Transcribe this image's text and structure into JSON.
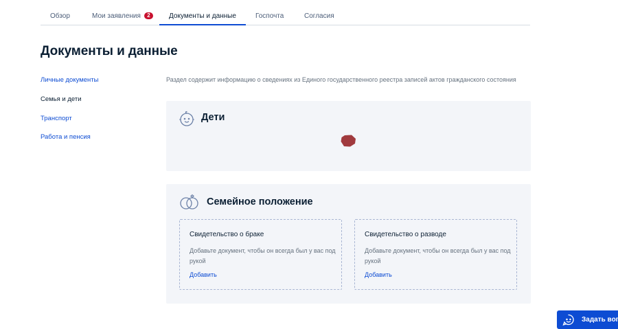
{
  "tabs": {
    "overview": "Обзор",
    "applications": "Мои заявления",
    "applications_badge": "2",
    "documents": "Документы и данные",
    "gospochta": "Госпочта",
    "consents": "Согласия"
  },
  "page": {
    "title": "Документы и данные",
    "description": "Раздел содержит информацию о сведениях из Единого государственного реестра записей актов гражданского состояния"
  },
  "sidebar": {
    "items": [
      {
        "label": "Личные документы"
      },
      {
        "label": "Семья и дети"
      },
      {
        "label": "Транспорт"
      },
      {
        "label": "Работа и пенсия"
      }
    ]
  },
  "children_card": {
    "title": "Дети"
  },
  "family_card": {
    "title": "Семейное положение",
    "marriage": {
      "title": "Свидетельство о браке",
      "text": "Добавьте документ, чтобы он всегда был у вас под рукой",
      "link": "Добавить"
    },
    "divorce": {
      "title": "Свидетельство о разводе",
      "text": "Добавьте документ, чтобы он всегда был у вас под рукой",
      "link": "Добавить"
    }
  },
  "help": {
    "label": "Задать вопрос"
  },
  "colors": {
    "accent": "#0d4cd3",
    "badge": "#c8102e",
    "spinner": "#a03a3e"
  },
  "icons": {
    "children": "baby-face-icon",
    "family": "wedding-rings-icon",
    "help": "chat-support-icon",
    "loading": "loading-spinner"
  }
}
